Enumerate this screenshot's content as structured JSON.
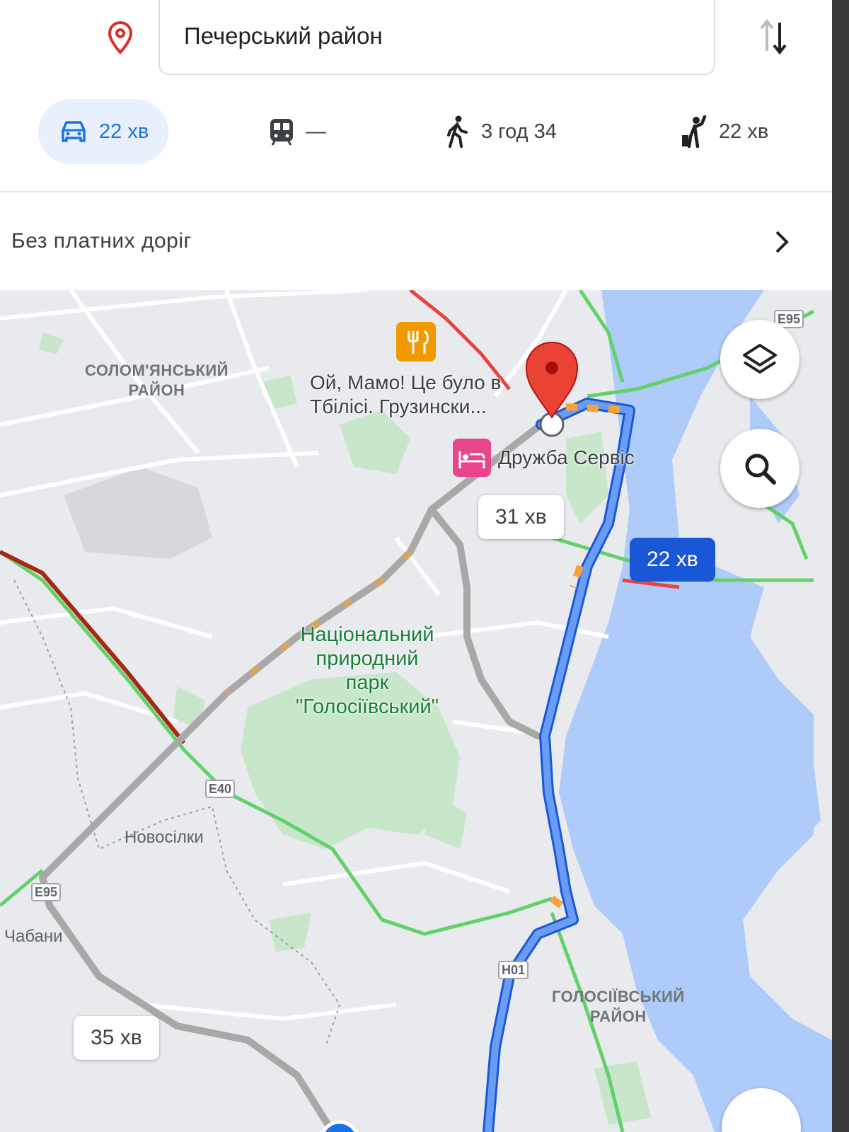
{
  "directions": {
    "destination": "Печерський район"
  },
  "modes": [
    {
      "name": "drive",
      "icon": "car-icon",
      "value": "22 хв",
      "selected": true
    },
    {
      "name": "transit",
      "icon": "train-icon",
      "value": "—",
      "selected": false
    },
    {
      "name": "walk",
      "icon": "walk-icon",
      "value": "3 год 34",
      "selected": false
    },
    {
      "name": "ride",
      "icon": "ride-hail-icon",
      "value": "22 хв",
      "selected": false
    }
  ],
  "options": {
    "label": "Без платних доріг"
  },
  "map": {
    "labels": {
      "solomyanskyi": "СОЛОМ'ЯНСЬКИЙ\nРАЙОН",
      "holosiivskyi": "ГОЛОСІЇВСЬКИЙ\nРАЙОН",
      "park": "Національний\nприродний\nпарк\n\"Голосіївський\"",
      "novosilky": "Новосілки",
      "chabany": "Чабани",
      "restaurant": "Ой, Мамо! Це було в\nТбілісі. Грузински...",
      "hotel": "Дружба Сервіс"
    },
    "shields": {
      "e40": "E40",
      "e95": "E95",
      "h01": "H01",
      "e95_top": "E95"
    },
    "callouts": {
      "primary": "22 хв",
      "alt1": "31 хв",
      "alt2": "35 хв"
    },
    "colors": {
      "route": "#4a7ff0",
      "route_outline": "#1a57d6",
      "alt_route": "#a8a8a8",
      "traffic_green": "#63d16a",
      "traffic_red": "#e8453c",
      "traffic_orange": "#f4a23c",
      "water": "#aecbfa",
      "park": "#c8e6c9",
      "pin": "#ea4335"
    }
  }
}
